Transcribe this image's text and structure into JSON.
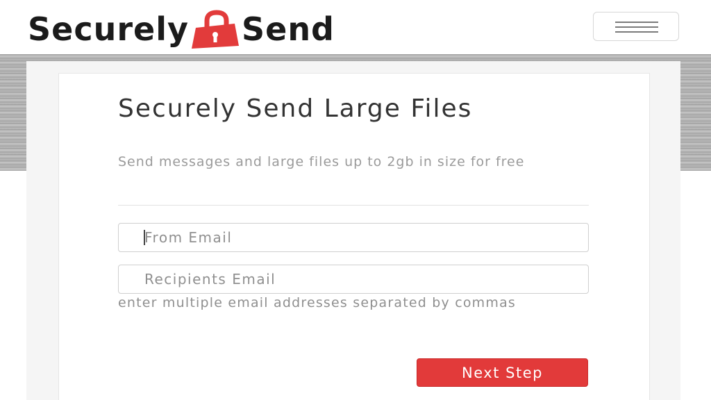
{
  "brand": {
    "word_left": "Securely",
    "word_right": "Send",
    "lock_color": "#e23b3b",
    "text_color": "#1b1b1b"
  },
  "nav": {
    "menu_icon": "hamburger-icon"
  },
  "form": {
    "title": "Securely Send Large Files",
    "subtitle": "Send messages and large files up to 2gb in size for free",
    "from_email": {
      "placeholder": "From Email",
      "value": ""
    },
    "recipients_email": {
      "placeholder": "Recipients Email",
      "value": ""
    },
    "recipients_help": "enter multiple email addresses separated by commas",
    "next_button_label": "Next Step"
  },
  "colors": {
    "accent": "#e23a3a",
    "muted_text": "#8f8f8f",
    "heading_text": "#333333"
  }
}
